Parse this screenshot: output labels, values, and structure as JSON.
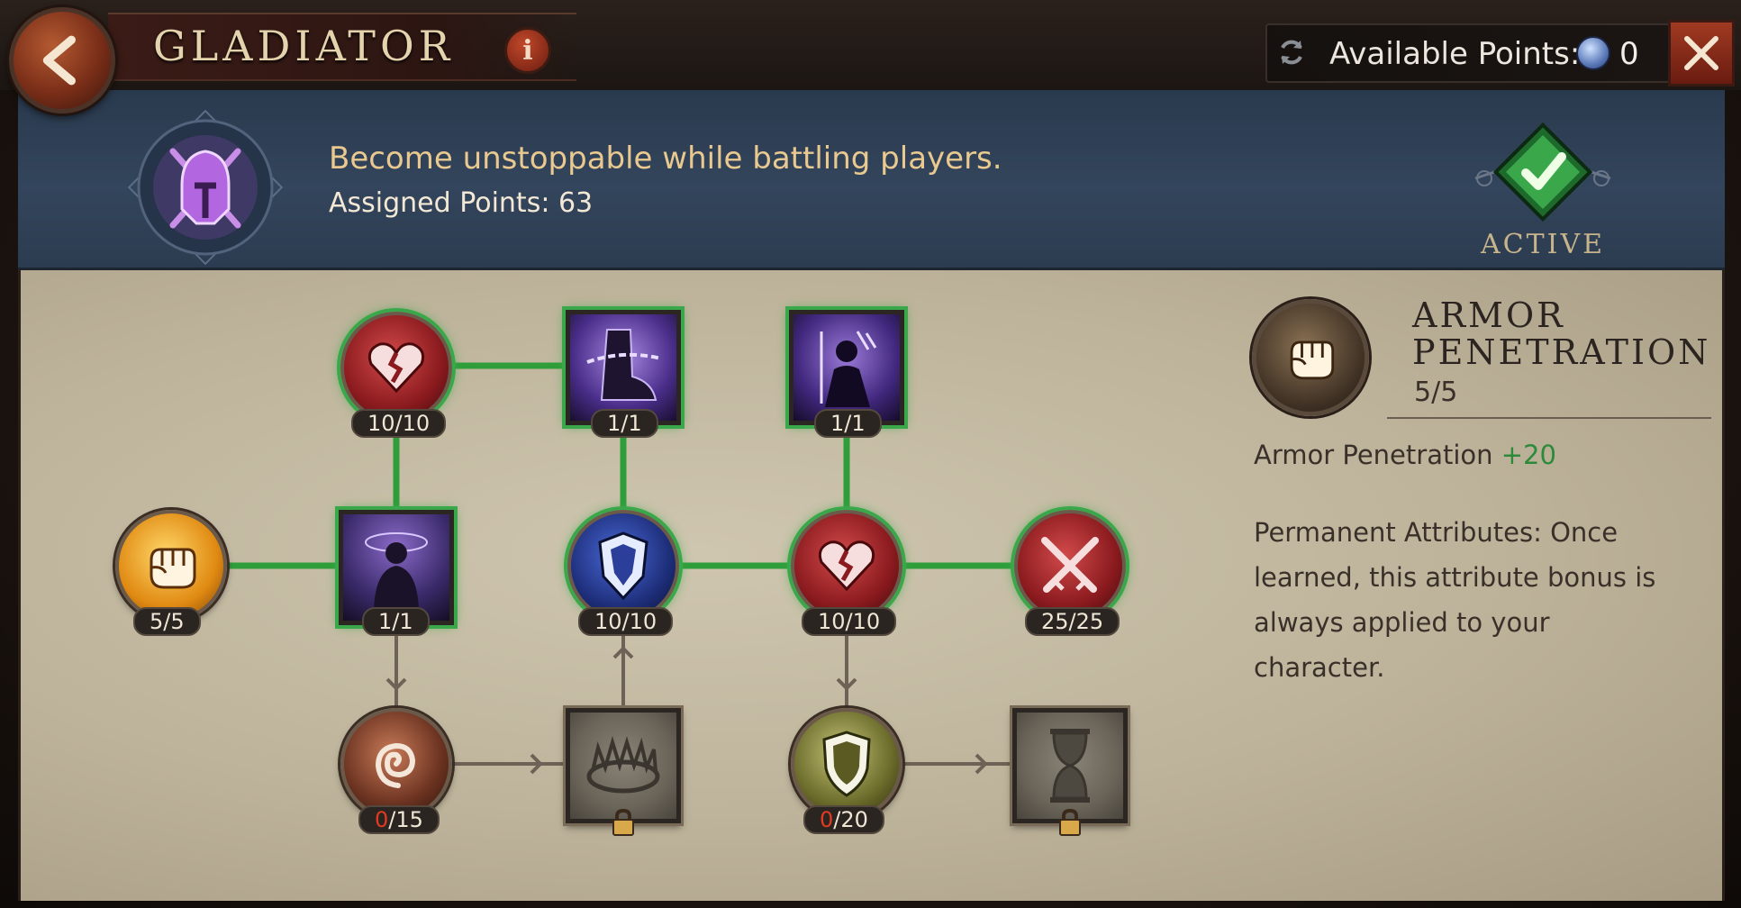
{
  "header": {
    "title": "GLADIATOR",
    "available_points_label": "Available Points:",
    "available_points_value": "0"
  },
  "banner": {
    "description": "Become unstoppable while battling players.",
    "assigned_points": "Assigned Points: 63",
    "status": "ACTIVE"
  },
  "tree": {
    "nodes": [
      {
        "id": "armor-penetration",
        "count": "5/5",
        "icon": "fist-icon",
        "shape": "round",
        "state": "maxed"
      },
      {
        "id": "top-heart",
        "count": "10/10",
        "icon": "broken-heart-icon",
        "shape": "round",
        "state": "maxed"
      },
      {
        "id": "dark-figure",
        "count": "1/1",
        "icon": "silhouette-icon",
        "shape": "square",
        "state": "maxed"
      },
      {
        "id": "chained-boot",
        "count": "1/1",
        "icon": "chained-boot-icon",
        "shape": "square",
        "state": "maxed"
      },
      {
        "id": "blue-shield",
        "count": "10/10",
        "icon": "crest-shield-icon",
        "shape": "round",
        "state": "maxed"
      },
      {
        "id": "archer",
        "count": "1/1",
        "icon": "archer-icon",
        "shape": "square",
        "state": "maxed"
      },
      {
        "id": "mid-heart",
        "count": "10/10",
        "icon": "broken-heart-icon",
        "shape": "round",
        "state": "maxed"
      },
      {
        "id": "crossed-swords",
        "count": "25/25",
        "icon": "crossed-swords-icon",
        "shape": "round",
        "state": "maxed"
      },
      {
        "id": "spiral",
        "count_current": "0",
        "count_max": "/15",
        "icon": "spiral-icon",
        "shape": "round",
        "state": "unlocked"
      },
      {
        "id": "bear-trap",
        "icon": "bear-trap-icon",
        "shape": "square",
        "state": "locked"
      },
      {
        "id": "shield",
        "count_current": "0",
        "count_max": "/20",
        "icon": "shield-icon",
        "shape": "round",
        "state": "unlocked"
      },
      {
        "id": "hourglass",
        "icon": "hourglass-icon",
        "shape": "square",
        "state": "locked"
      }
    ]
  },
  "detail": {
    "title": "ARMOR PENETRATION",
    "level": "5/5",
    "stat_name": "Armor Penetration",
    "stat_value": "+20",
    "description": "Permanent Attributes: Once learned, this attribute bonus is always applied to your character."
  },
  "colors": {
    "active_link": "#2f9e3a",
    "inactive_link": "#6e6256",
    "accent_gold": "#e9c98f",
    "stat_green": "#2d8a3a",
    "zero_red": "#e23a22"
  }
}
